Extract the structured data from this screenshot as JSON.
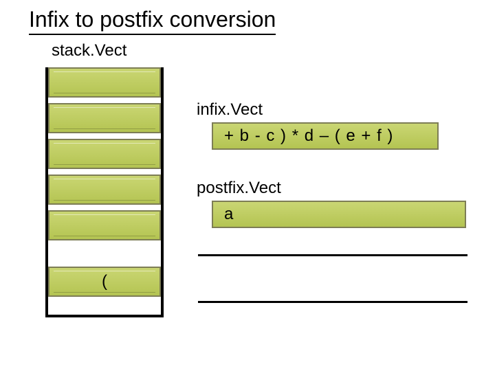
{
  "title": "Infix to postfix conversion",
  "labels": {
    "stack": "stack.Vect",
    "infix": "infix.Vect",
    "postfix": "postfix.Vect"
  },
  "stack": {
    "slots": [
      "",
      "",
      "",
      "",
      "",
      "("
    ]
  },
  "infix_value": "+ b - c ) * d – ( e + f )",
  "postfix_value": "a"
}
